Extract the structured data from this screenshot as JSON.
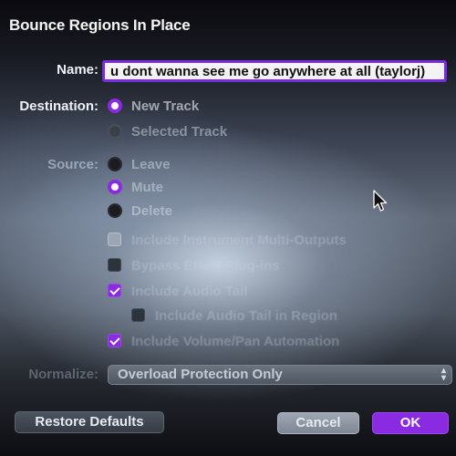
{
  "dialog": {
    "title": "Bounce Regions In Place"
  },
  "name": {
    "label": "Name:",
    "value": "u dont wanna see me go anywhere at all (taylorj)"
  },
  "destination": {
    "label": "Destination:",
    "options": [
      {
        "label": "New Track",
        "selected": true
      },
      {
        "label": "Selected Track",
        "selected": false
      }
    ]
  },
  "source": {
    "label": "Source:",
    "options": [
      {
        "label": "Leave",
        "selected": false
      },
      {
        "label": "Mute",
        "selected": true
      },
      {
        "label": "Delete",
        "selected": false
      }
    ]
  },
  "checkboxes": [
    {
      "label": "Include Instrument Multi-Outputs",
      "checked": false
    },
    {
      "label": "Bypass Effect Plug-ins",
      "checked": false
    },
    {
      "label": "Include Audio Tail",
      "checked": true
    },
    {
      "label": "Include Audio Tail in Region",
      "checked": false
    },
    {
      "label": "Include Volume/Pan Automation",
      "checked": true
    }
  ],
  "normalize": {
    "label": "Normalize:",
    "value": "Overload Protection Only"
  },
  "buttons": {
    "restore": "Restore Defaults",
    "cancel": "Cancel",
    "ok": "OK"
  },
  "colors": {
    "accent": "#8a2be2"
  }
}
